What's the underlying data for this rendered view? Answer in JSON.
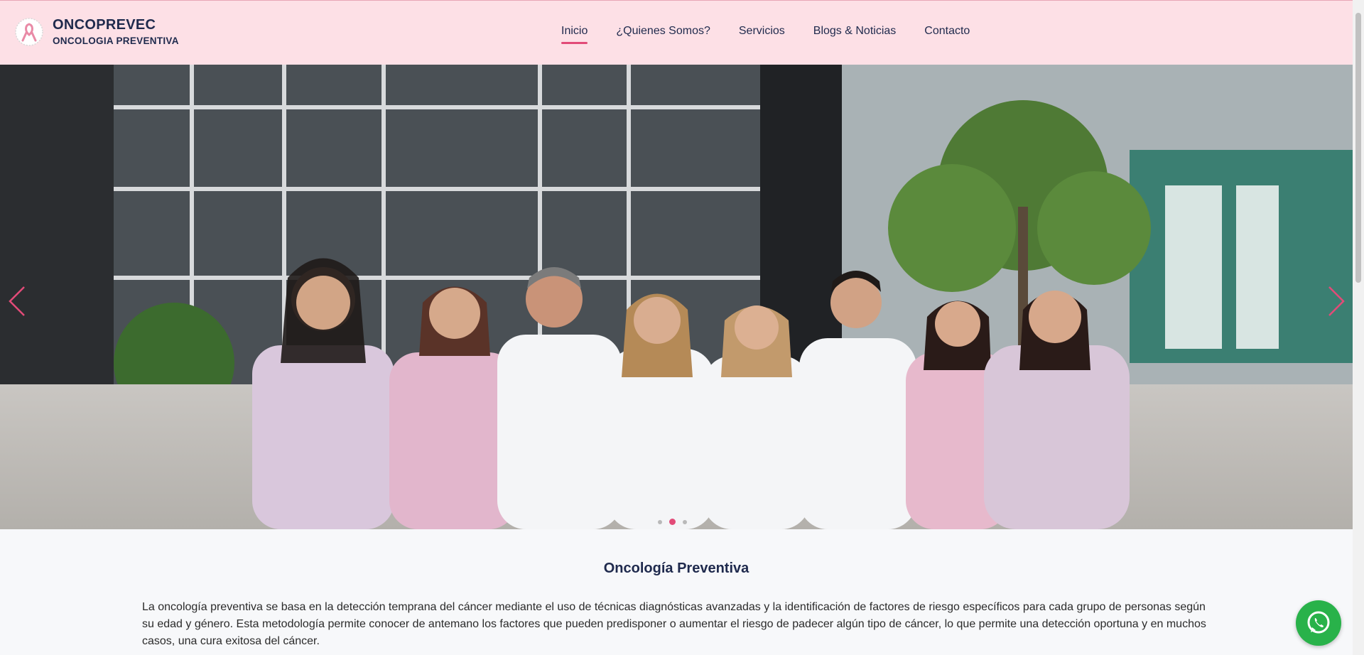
{
  "brand": {
    "title": "ONCOPREVEC",
    "subtitle": "ONCOLOGIA PREVENTIVA",
    "logo_icon": "pink-ribbon-logo-icon"
  },
  "nav": {
    "items": [
      {
        "label": "Inicio",
        "active": true
      },
      {
        "label": "¿Quienes Somos?",
        "active": false
      },
      {
        "label": "Servicios",
        "active": false
      },
      {
        "label": "Blogs & Noticias",
        "active": false
      },
      {
        "label": "Contacto",
        "active": false
      }
    ]
  },
  "hero": {
    "image_subject": "team-photo",
    "prev_icon": "chevron-left-icon",
    "next_icon": "chevron-right-icon",
    "slides_count": 3,
    "active_slide": 2
  },
  "section": {
    "title": "Oncología Preventiva",
    "text": "La oncología preventiva se basa en la detección temprana del cáncer mediante el uso de técnicas diagnósticas avanzadas y la identificación de factores de riesgo específicos para cada grupo de personas según su edad y género. Esta metodología permite conocer de antemano los factores que pueden predisponer o aumentar el riesgo de padecer algún tipo de cáncer, lo que permite una detección oportuna y en muchos casos, una cura exitosa del cáncer."
  },
  "whatsapp": {
    "icon": "whatsapp-icon"
  },
  "colors": {
    "header_bg": "#fde0e6",
    "accent": "#e24b78",
    "brand_text": "#1f2a4d",
    "whatsapp": "#29b24a"
  }
}
